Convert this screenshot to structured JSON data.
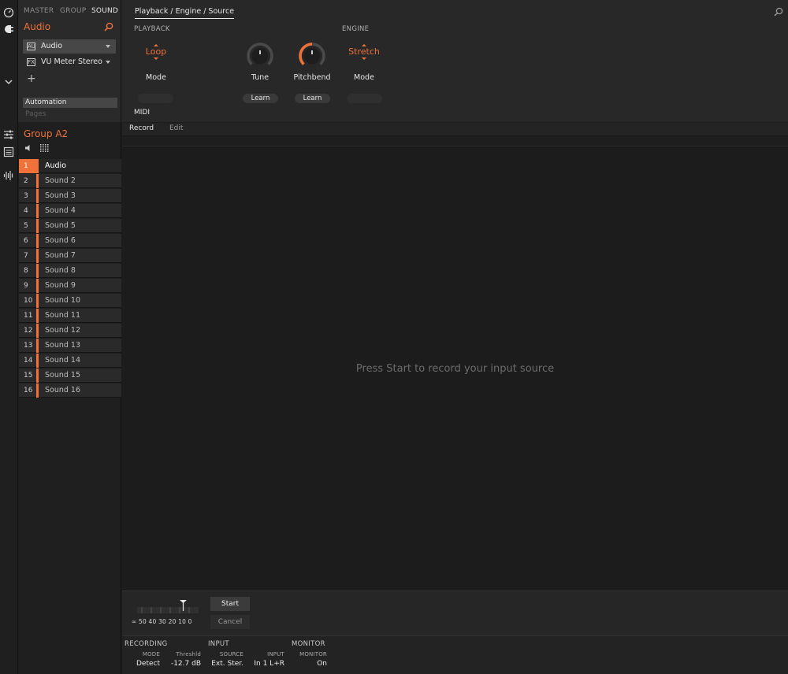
{
  "toolstrip": {
    "icons": [
      "clock-icon",
      "plug-icon",
      "chevron-down-icon",
      "controls-icon",
      "list-icon",
      "waveform-icon"
    ]
  },
  "browser": {
    "tabs": [
      "MASTER",
      "GROUP",
      "SOUND"
    ],
    "active_tab": "SOUND",
    "plugin_title": "Audio",
    "slots": [
      {
        "badge": "AU",
        "label": "Audio"
      },
      {
        "badge": "FX",
        "label": "VU Meter Stereo"
      }
    ],
    "add_symbol": "+",
    "automation_label": "Automation",
    "pages_label": "Pages"
  },
  "params": {
    "page_tab": "Playback / Engine / Source",
    "sections": {
      "playback": "PLAYBACK",
      "engine": "ENGINE"
    },
    "playback_mode": {
      "value": "Loop",
      "name": "Mode"
    },
    "tune": {
      "name": "Tune",
      "learn": "Learn",
      "level": 0.5
    },
    "pitchbend": {
      "name": "Pitchbend",
      "learn": "Learn",
      "level": 0.5
    },
    "engine_mode": {
      "value": "Stretch",
      "name": "Mode"
    },
    "midi_label": "MIDI"
  },
  "group": {
    "name": "Group A2",
    "sounds": [
      {
        "num": "1",
        "label": "Audio",
        "selected": true
      },
      {
        "num": "2",
        "label": "Sound 2"
      },
      {
        "num": "3",
        "label": "Sound 3"
      },
      {
        "num": "4",
        "label": "Sound 4"
      },
      {
        "num": "5",
        "label": "Sound 5"
      },
      {
        "num": "6",
        "label": "Sound 6"
      },
      {
        "num": "7",
        "label": "Sound 7"
      },
      {
        "num": "8",
        "label": "Sound 8"
      },
      {
        "num": "9",
        "label": "Sound 9"
      },
      {
        "num": "10",
        "label": "Sound 10"
      },
      {
        "num": "11",
        "label": "Sound 11"
      },
      {
        "num": "12",
        "label": "Sound 12"
      },
      {
        "num": "13",
        "label": "Sound 13"
      },
      {
        "num": "14",
        "label": "Sound 14"
      },
      {
        "num": "15",
        "label": "Sound 15"
      },
      {
        "num": "16",
        "label": "Sound 16"
      }
    ]
  },
  "editor": {
    "tabs": [
      "Record",
      "Edit"
    ],
    "active_tab": "Record",
    "empty_message": "Press Start to record your input source"
  },
  "recorder": {
    "meter_scale": "∞ 50 40 30 20 10  0",
    "start_label": "Start",
    "cancel_label": "Cancel"
  },
  "footer": {
    "recording_header": "RECORDING",
    "input_header": "INPUT",
    "monitor_header": "MONITOR",
    "mode_label": "MODE",
    "mode_value": "Detect",
    "threshold_label": "Threshld",
    "threshold_value": "-12.7 dB",
    "source_label": "SOURCE",
    "source_value": "Ext. Ster.",
    "input_label": "INPUT",
    "input_value": "In 1 L+R",
    "monitor_label": "MONITOR",
    "monitor_value": "On"
  },
  "colors": {
    "accent": "#f0713a",
    "background": "#1c1c1c",
    "panel": "#282828"
  }
}
